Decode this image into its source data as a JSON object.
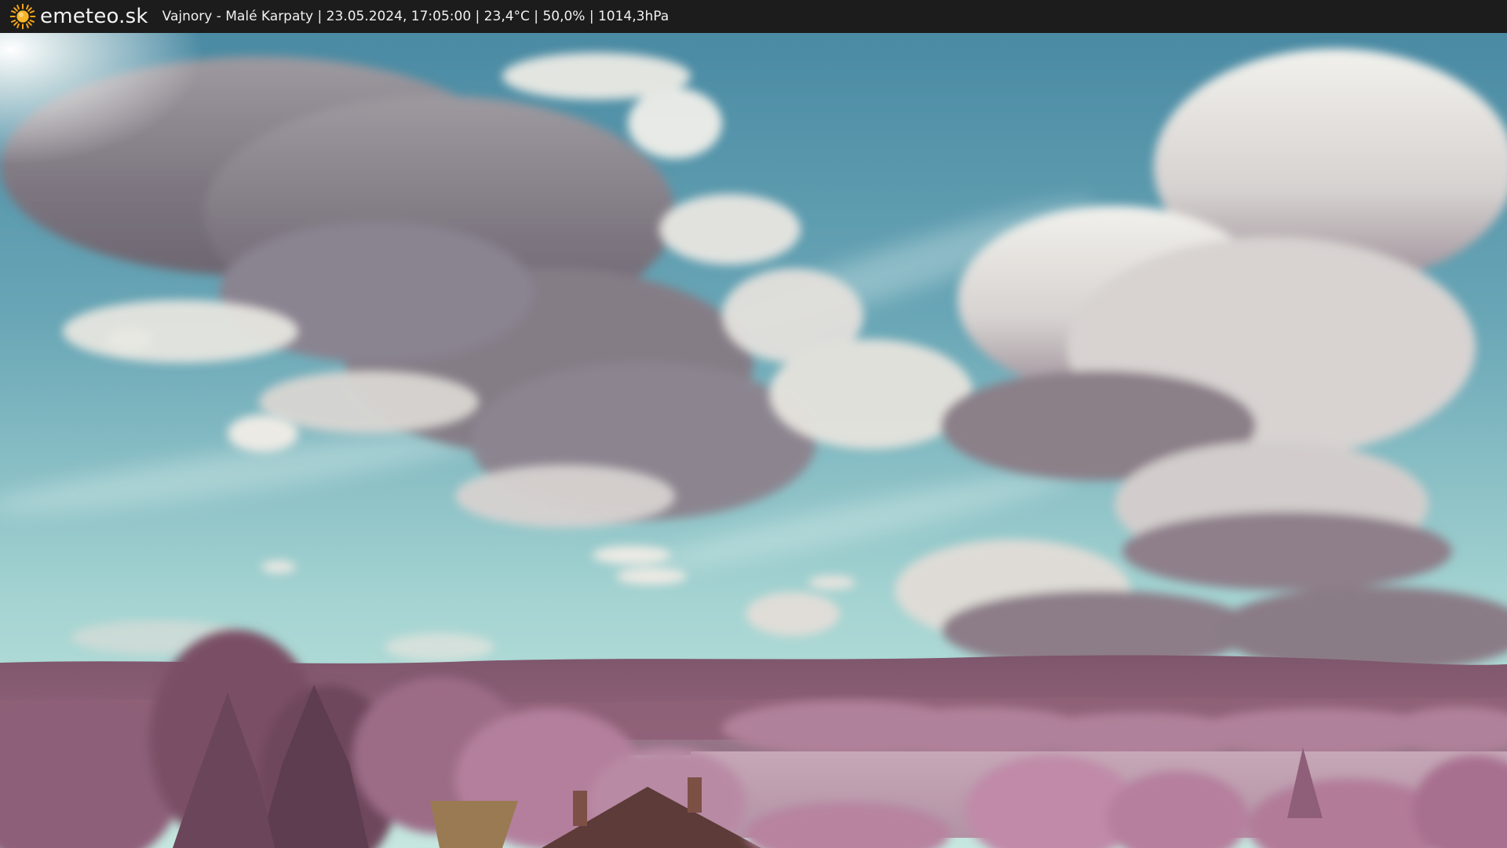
{
  "header": {
    "logo_text": "emeteo.sk",
    "logo_icon": "sun-icon",
    "caption": "Vajnory - Malé Karpaty | 23.05.2024, 17:05:00 | 23,4°C | 50,0% | 1014,3hPa"
  },
  "colors": {
    "bar": "#1c1c1c",
    "sun": "#f2a51a",
    "sky_top": "#4e8fa6",
    "sky_horizon": "#bfe2dc",
    "foliage": "#b27b9a",
    "hills": "#8a5f74"
  }
}
